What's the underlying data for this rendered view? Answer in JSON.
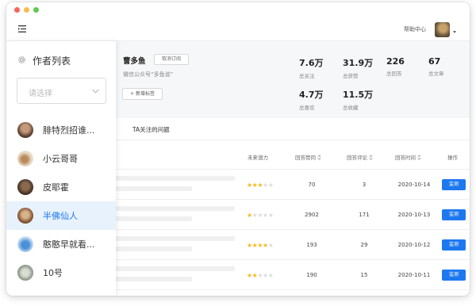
{
  "topbar": {
    "help_label": "帮助中心"
  },
  "sidebar": {
    "title": "作者列表",
    "select_placeholder": "请选择",
    "items": [
      {
        "name": "腓特烈招谁...",
        "active": false
      },
      {
        "name": "小云哥哥",
        "active": false
      },
      {
        "name": "皮耶霍",
        "active": false
      },
      {
        "name": "半佛仙人",
        "active": true
      },
      {
        "name": "憨憨早就看...",
        "active": false
      },
      {
        "name": "10号",
        "active": false
      }
    ]
  },
  "profile": {
    "name": "曹多鱼",
    "unsubscribe_label": "取消订阅",
    "subtitle": "微信公众号“多鱼说”",
    "add_tag_label": "+ 新增标签",
    "stats": [
      {
        "value": "7.6万",
        "label": "总关注"
      },
      {
        "value": "31.9万",
        "label": "总获赞"
      },
      {
        "value": "226",
        "label": "总回答"
      },
      {
        "value": "67",
        "label": "总文章"
      },
      {
        "value": "4.7万",
        "label": "总喜欢"
      },
      {
        "value": "11.5万",
        "label": "总收藏"
      }
    ]
  },
  "tabs": [
    {
      "label": "TA关注的问题"
    }
  ],
  "table": {
    "headers": {
      "potential": "未来潜力",
      "upvotes": "回答赞同",
      "comments": "回答评论",
      "time": "回答时间",
      "action": "操作"
    },
    "rows": [
      {
        "stars": 3,
        "upvotes": "70",
        "comments": "3",
        "time": "2020-10-14",
        "action": "监测"
      },
      {
        "stars": 1,
        "upvotes": "2902",
        "comments": "171",
        "time": "2020-10-13",
        "action": "监测"
      },
      {
        "stars": 4,
        "upvotes": "193",
        "comments": "29",
        "time": "2020-10-12",
        "action": "监测"
      },
      {
        "stars": 2,
        "upvotes": "190",
        "comments": "15",
        "time": "2020-10-11",
        "action": "监测"
      }
    ]
  },
  "colors": {
    "accent": "#1d78f0",
    "star": "#f6b91d",
    "active_bg": "#e8f2fd"
  }
}
